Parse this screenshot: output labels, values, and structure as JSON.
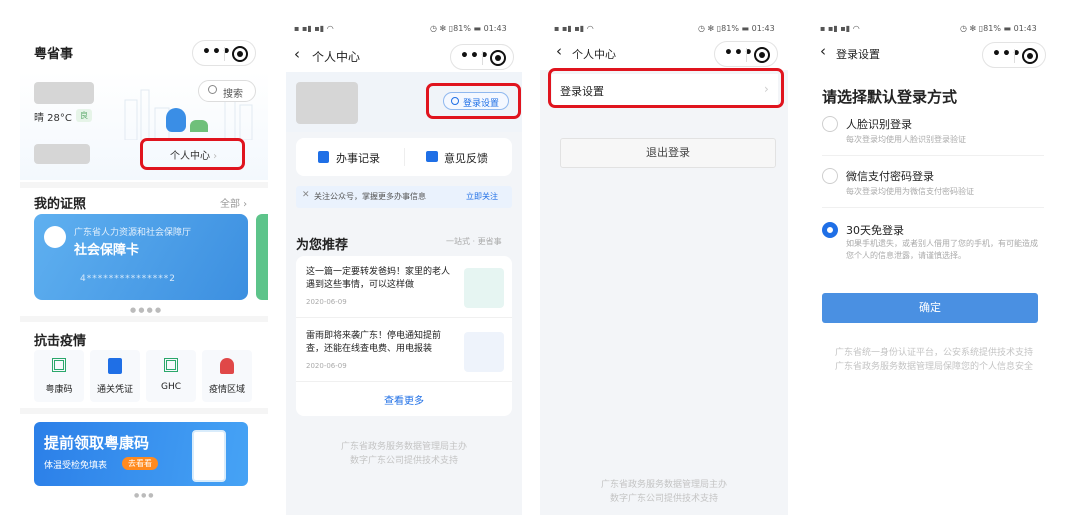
{
  "screen1": {
    "title": "粤省事",
    "search": "搜索",
    "weather": "晴 28°C",
    "aqi": "良",
    "personal_center": "个人中心",
    "my_certs": "我的证照",
    "all": "全部",
    "card_org": "广东省人力资源和社会保障厅",
    "card_name": "社会保障卡",
    "card_number": "4***************2",
    "epidemic_title": "抗击疫情",
    "epidemic_items": [
      "粤康码",
      "通关凭证",
      "GHC",
      "疫情区域"
    ],
    "banner_title": "提前领取粤康码",
    "banner_sub": "体温受检免填表",
    "banner_btn": "去看看"
  },
  "screen2": {
    "status_time": "01:43",
    "status_batt": "81%",
    "title": "个人中心",
    "login_settings": "登录设置",
    "records": "办事记录",
    "feedback": "意见反馈",
    "follow_tip": "关注公众号，掌握更多办事信息",
    "follow_btn": "立即关注",
    "recommend_title": "为您推荐",
    "recommend_sub": "一站式 · 更省事",
    "articles": [
      {
        "title": "这一篇一定要转发爸妈！家里的老人遇到这些事情，可以这样做",
        "date": "2020-06-09"
      },
      {
        "title": "雷雨即将来袭广东！停电通知提前查，还能在线查电费、用电报装",
        "date": "2020-06-09"
      }
    ],
    "more": "查看更多",
    "footer": [
      "广东省政务服务数据管理局主办",
      "数字广东公司提供技术支持"
    ]
  },
  "screen3": {
    "status_time": "01:43",
    "status_batt": "81%",
    "title": "个人中心",
    "login_settings": "登录设置",
    "logout": "退出登录",
    "footer": [
      "广东省政务服务数据管理局主办",
      "数字广东公司提供技术支持"
    ]
  },
  "screen4": {
    "status_time": "01:43",
    "status_batt": "81%",
    "title": "登录设置",
    "heading": "请选择默认登录方式",
    "options": [
      {
        "label": "人脸识别登录",
        "desc": "每次登录均使用人脸识别登录验证"
      },
      {
        "label": "微信支付密码登录",
        "desc": "每次登录均使用为微信支付密码验证"
      },
      {
        "label": "30天免登录",
        "desc": "如果手机遗失，或者别人借用了您的手机，有可能造成您个人的信息泄露，请谨慎选择。"
      }
    ],
    "confirm": "确定",
    "footer": [
      "广东省统一身份认证平台，公安系统提供技术支持",
      "广东省政务服务数据管理局保障您的个人信息安全"
    ]
  },
  "colors": {
    "accent": "#1f6fe6",
    "highlight": "#e0141e",
    "card_blue": "#4a9be8",
    "confirm_blue": "#4a90e2"
  }
}
